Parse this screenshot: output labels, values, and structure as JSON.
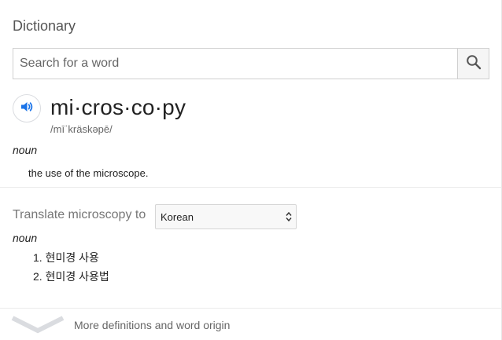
{
  "header": {
    "title": "Dictionary"
  },
  "search": {
    "placeholder": "Search for a word",
    "value": ""
  },
  "entry": {
    "headword": "mi·cros·co·py",
    "phonetic": "/mīˈkräskəpē/",
    "part_of_speech": "noun",
    "definition": "the use of the microscope."
  },
  "translate": {
    "label": "Translate microscopy to",
    "selected_language": "Korean",
    "part_of_speech": "noun",
    "items": [
      "1. 현미경 사용",
      "2. 현미경 사용법"
    ]
  },
  "footer": {
    "more_label": "More definitions and word origin"
  },
  "colors": {
    "accent_blue": "#1a73e8",
    "chevron_gray": "#dadce0"
  },
  "icons": {
    "speaker": "speaker-icon",
    "search": "search-icon",
    "select": "select-arrows-icon",
    "more": "chevron-down-icon"
  }
}
